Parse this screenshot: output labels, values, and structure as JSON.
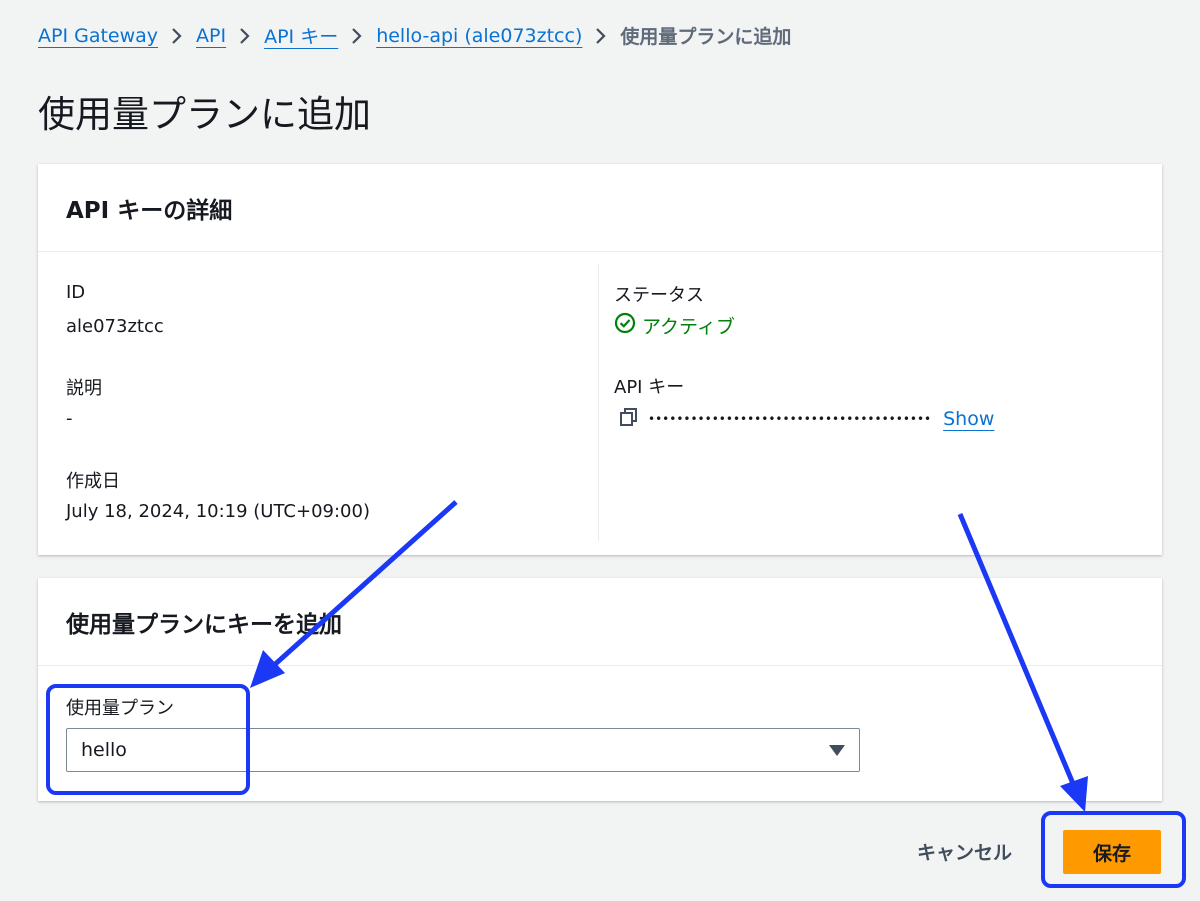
{
  "breadcrumb": {
    "items": [
      {
        "label": "API Gateway"
      },
      {
        "label": "API"
      },
      {
        "label": "API キー"
      },
      {
        "label": "hello-api (ale073ztcc)"
      }
    ],
    "current": "使用量プランに追加"
  },
  "page": {
    "title": "使用量プランに追加"
  },
  "details_panel": {
    "heading": "API キーの詳細",
    "id_label": "ID",
    "id_value": "ale073ztcc",
    "description_label": "説明",
    "description_value": "-",
    "created_label": "作成日",
    "created_value": "July 18, 2024, 10:19 (UTC+09:00)",
    "status_label": "ステータス",
    "status_value": "アクティブ",
    "apikey_label": "API キー",
    "apikey_masked": "••••••••••••••••••••••••••••••••••••••••",
    "show_label": "Show"
  },
  "plan_panel": {
    "heading": "使用量プランにキーを追加",
    "field_label": "使用量プラン",
    "selected_value": "hello"
  },
  "actions": {
    "cancel_label": "キャンセル",
    "save_label": "保存"
  },
  "colors": {
    "link": "#0972d3",
    "primary_button": "#ff9900",
    "status_success": "#037f0c",
    "annotation": "#1b38f5",
    "background": "#f2f3f3"
  },
  "icons": {
    "breadcrumb_separator": "chevron-right-icon",
    "status": "check-circle-icon",
    "copy": "copy-icon",
    "select_caret": "caret-down-icon"
  }
}
